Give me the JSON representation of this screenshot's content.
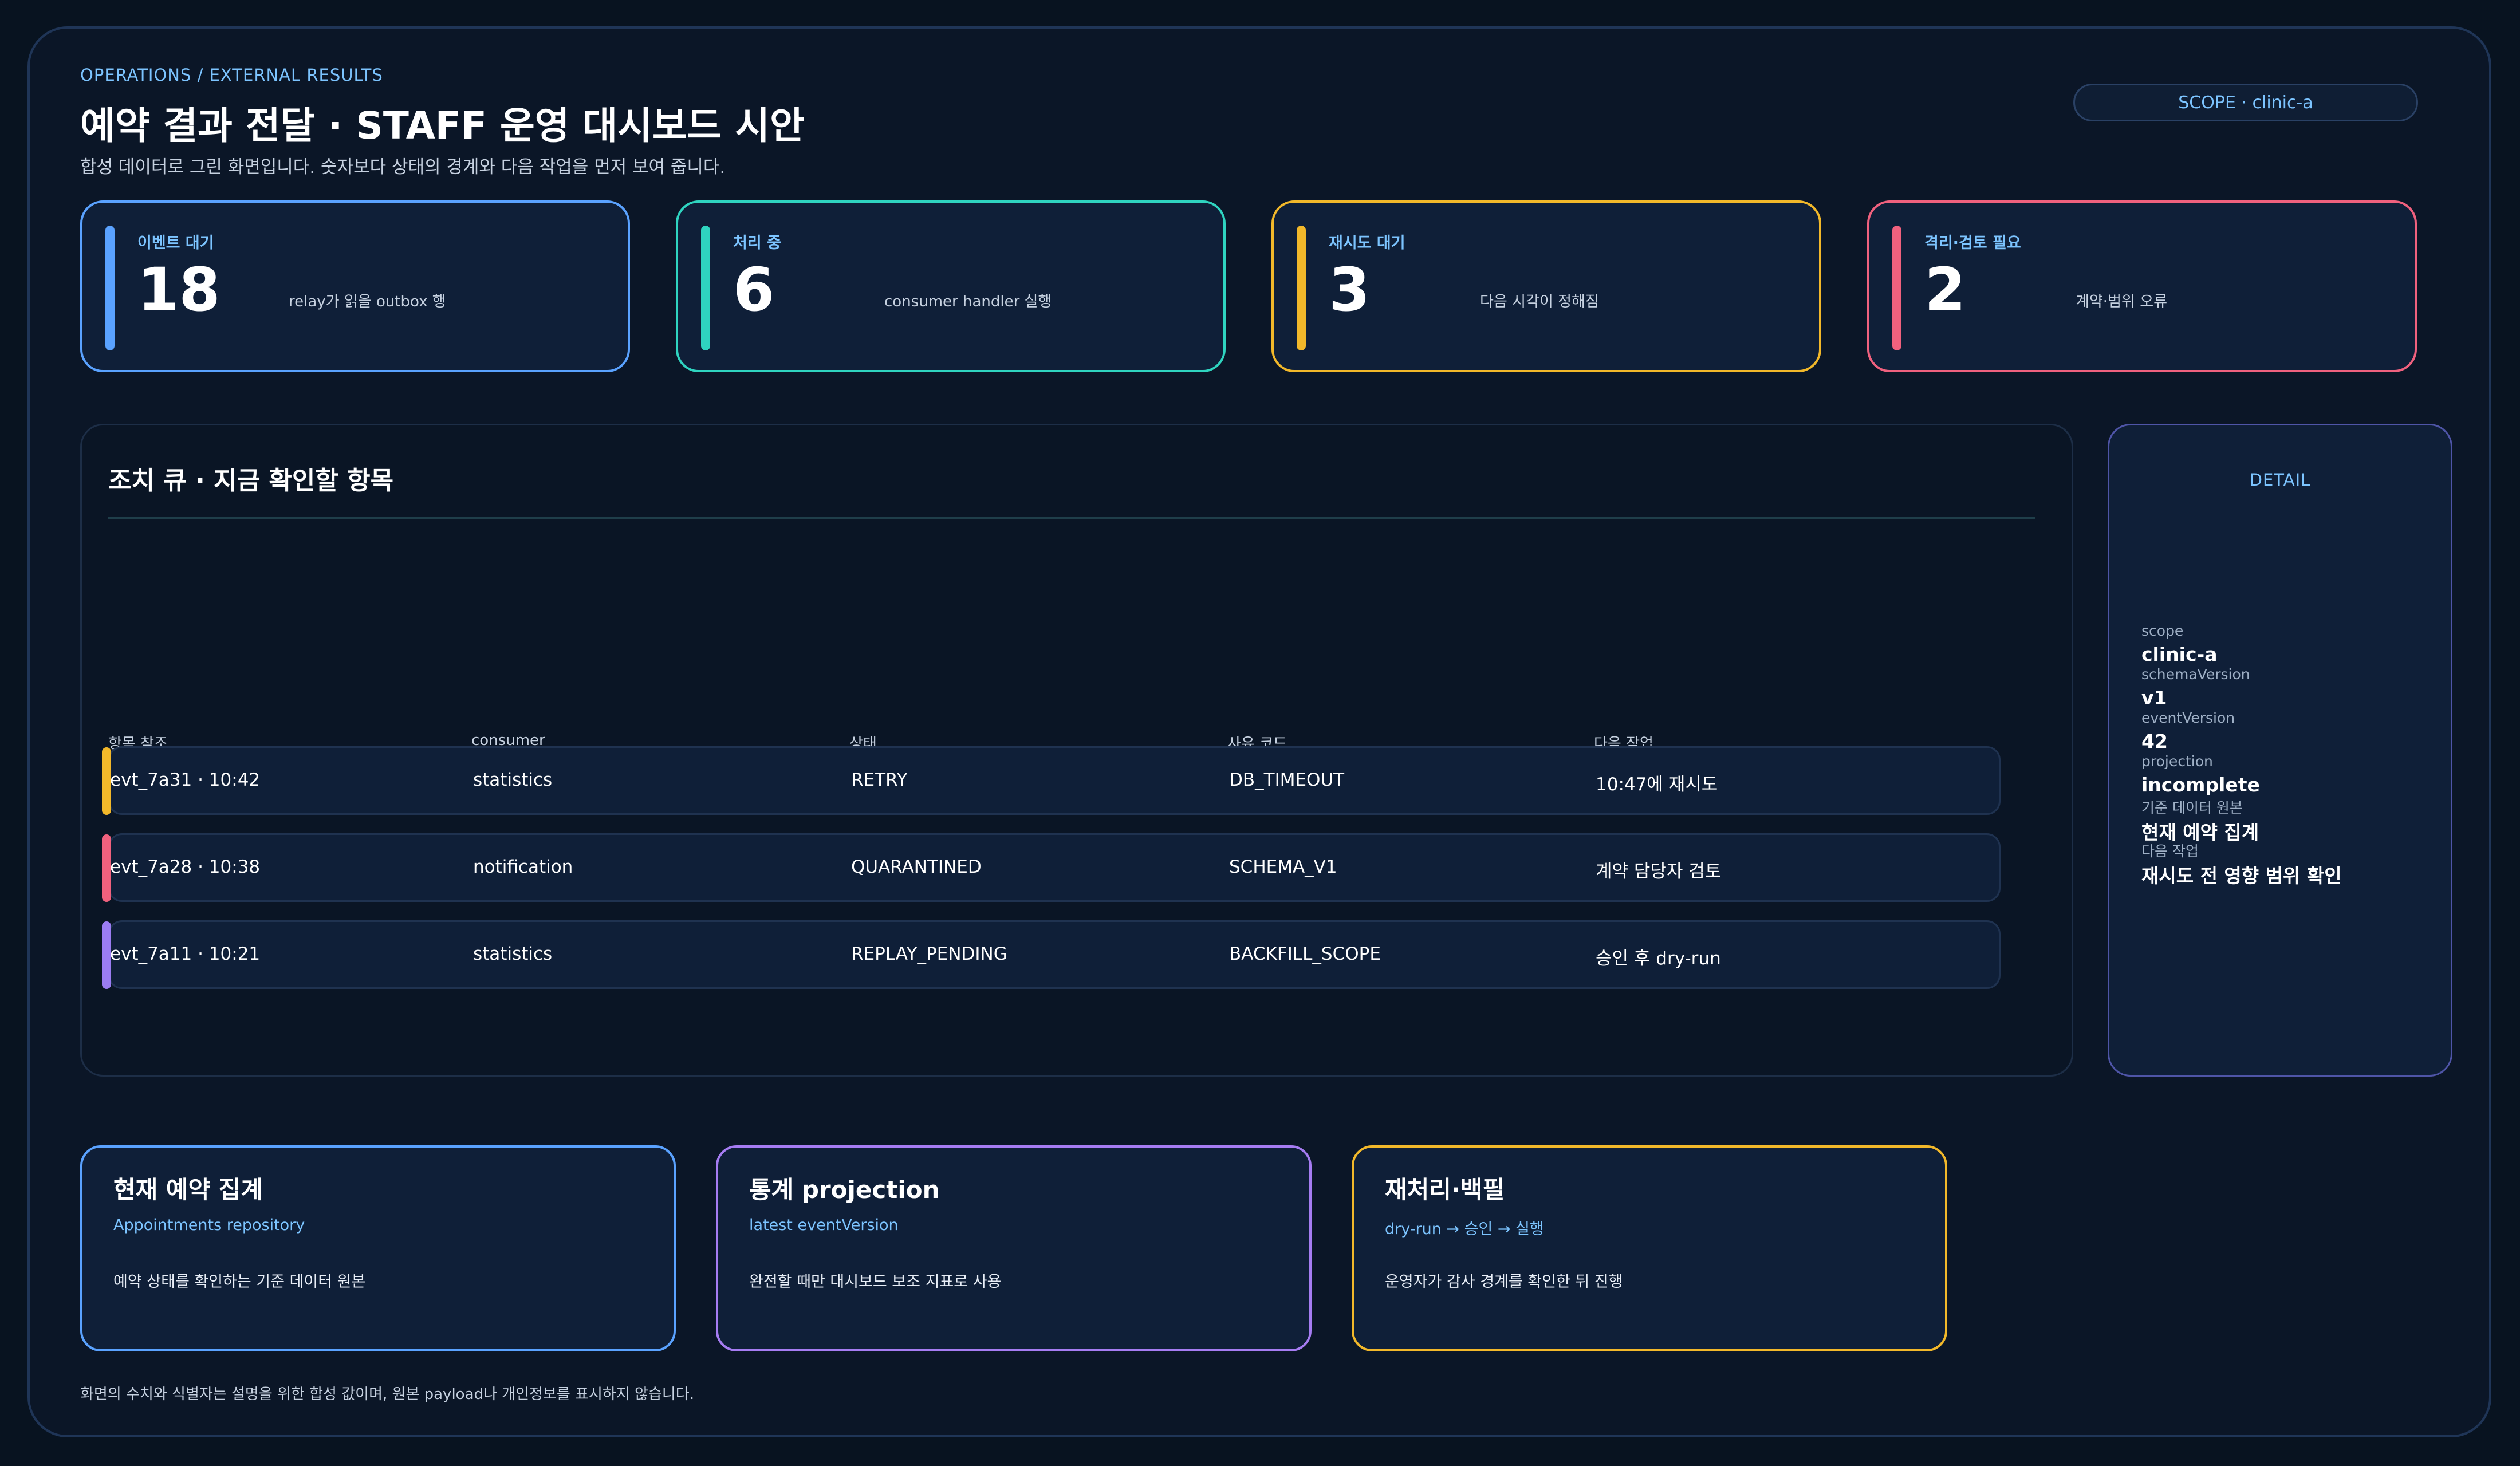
{
  "header": {
    "breadcrumb": "OPERATIONS / EXTERNAL RESULTS",
    "title": "예약 결과 전달 · STAFF 운영 대시보드 시안",
    "subtitle": "합성 데이터로 그린 화면입니다. 숫자보다 상태의 경계와 다음 작업을 먼저 보여 줍니다.",
    "scope": "SCOPE · clinic-a"
  },
  "stats": [
    {
      "label": "이벤트 대기",
      "value": "18",
      "note": "relay가 읽을 outbox 행",
      "color": "#5aa2ff"
    },
    {
      "label": "처리 중",
      "value": "6",
      "note": "consumer handler 실행",
      "color": "#2fd4c0"
    },
    {
      "label": "재시도 대기",
      "value": "3",
      "note": "다음 시각이 정해짐",
      "color": "#f2b82a"
    },
    {
      "label": "격리·검토 필요",
      "value": "2",
      "note": "계약·범위 오류",
      "color": "#f0617e"
    }
  ],
  "queue": {
    "title": "조치 큐 · 지금 확인할 항목",
    "columns": [
      "항목 참조",
      "consumer",
      "상태",
      "사유 코드",
      "다음 작업"
    ],
    "rows": [
      {
        "ref": "evt_7a31 · 10:42",
        "consumer": "statistics",
        "status": "RETRY",
        "reason": "DB_TIMEOUT",
        "next": "10:47에 재시도",
        "color": "#f2b82a"
      },
      {
        "ref": "evt_7a28 · 10:38",
        "consumer": "notification",
        "status": "QUARANTINED",
        "reason": "SCHEMA_V1",
        "next": "계약 담당자 검토",
        "color": "#f0617e"
      },
      {
        "ref": "evt_7a11 · 10:21",
        "consumer": "statistics",
        "status": "REPLAY_PENDING",
        "reason": "BACKFILL_SCOPE",
        "next": "승인 후 dry-run",
        "color": "#9b7cf2"
      }
    ]
  },
  "detail": {
    "heading": "DETAIL",
    "fields": [
      {
        "label": "scope",
        "value": "clinic-a"
      },
      {
        "label": "schemaVersion",
        "value": "v1"
      },
      {
        "label": "eventVersion",
        "value": "42"
      },
      {
        "label": "projection",
        "value": "incomplete"
      },
      {
        "label": "기준 데이터 원본",
        "value": "현재 예약 집계"
      },
      {
        "label": "다음 작업",
        "value": "재시도 전 영향 범위 확인"
      }
    ]
  },
  "info_cards": [
    {
      "title": "현재 예약 집계",
      "subtitle": "Appointments repository",
      "desc": "예약 상태를 확인하는 기준 데이터 원본",
      "color": "#5aa2ff"
    },
    {
      "title": "통계 projection",
      "subtitle": "latest eventVersion",
      "desc": "완전할 때만 대시보드 보조 지표로 사용",
      "color": "#a67cf2"
    },
    {
      "title": "재처리·백필",
      "subtitle": "dry-run → 승인 → 실행",
      "desc": "운영자가 감사 경계를 확인한 뒤 진행",
      "color": "#f2b82a"
    }
  ],
  "footer": "화면의 수치와 식별자는 설명을 위한 합성 값이며, 원본 payload나 개인정보를 표시하지 않습니다."
}
